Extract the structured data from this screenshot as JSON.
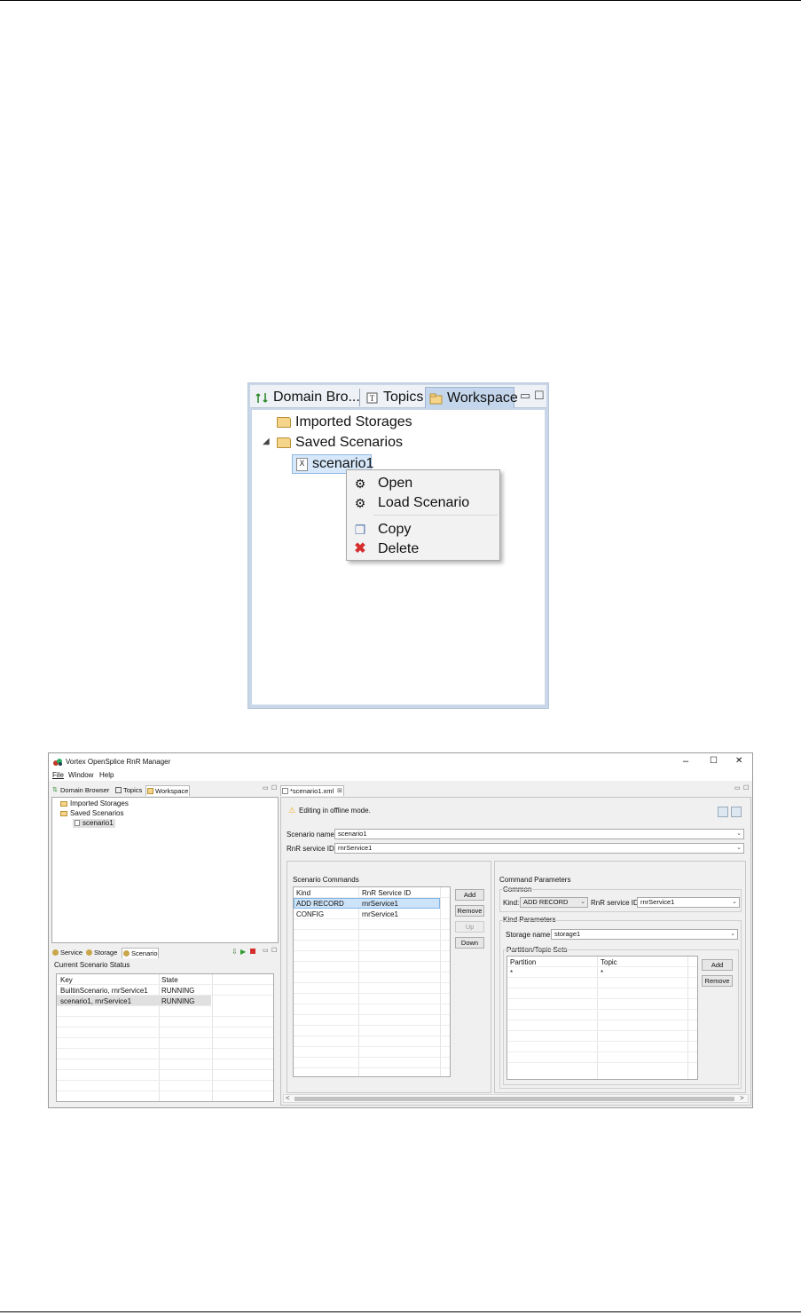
{
  "zoom_view": {
    "tabs": [
      {
        "label": "Domain Bro...",
        "icon": "domain-browser-icon"
      },
      {
        "label": "Topics",
        "icon": "topics-icon"
      },
      {
        "label": "Workspace",
        "icon": "workspace-icon"
      }
    ],
    "tree": {
      "imported_storages": "Imported Storages",
      "saved_scenarios": "Saved Scenarios",
      "scenario": "scenario1"
    },
    "context_menu": {
      "open": "Open",
      "load_scenario": "Load Scenario",
      "copy": "Copy",
      "delete": "Delete"
    }
  },
  "window": {
    "title": "Vortex OpenSplice RnR Manager",
    "menu": [
      "File",
      "Window",
      "Help"
    ],
    "controls": {
      "minimize": "–",
      "maximize": "☐",
      "close": "✕"
    },
    "left_tabs": [
      "Domain Browser",
      "Topics",
      "Workspace"
    ],
    "tree": {
      "imported_storages": "Imported Storages",
      "saved_scenarios": "Saved Scenarios",
      "scenario": "scenario1"
    },
    "bottom_tabs": [
      "Service",
      "Storage",
      "Scenario"
    ],
    "status": {
      "title": "Current Scenario Status",
      "columns": [
        "Key",
        "State"
      ],
      "rows": [
        [
          "BuiltinScenario, rnrService1",
          "RUNNING"
        ],
        [
          "scenario1, rnrService1",
          "RUNNING"
        ]
      ]
    },
    "editor": {
      "tab": "*scenario1.xml",
      "notice": "Editing in offline mode.",
      "scenario_name_label": "Scenario name:",
      "scenario_name": "scenario1",
      "service_id_label": "RnR service ID:",
      "service_id": "rnrService1",
      "commands": {
        "title": "Scenario Commands",
        "columns": [
          "Kind",
          "RnR Service ID"
        ],
        "rows": [
          [
            "ADD RECORD",
            "rnrService1"
          ],
          [
            "CONFIG",
            "rnrService1"
          ]
        ],
        "buttons": {
          "add": "Add",
          "remove": "Remove",
          "up": "Up",
          "down": "Down"
        }
      },
      "params": {
        "title": "Command Parameters",
        "common": "Common",
        "kind_label": "Kind:",
        "kind": "ADD RECORD",
        "service_label": "RnR service ID:",
        "service": "rnrService1",
        "kind_params": "Kind Parameters",
        "storage_label": "Storage name:",
        "storage": "storage1",
        "sets_title": "Partition/Topic Sets",
        "columns": [
          "Partition",
          "Topic"
        ],
        "rows": [
          [
            "*",
            "*"
          ]
        ],
        "buttons": {
          "add": "Add",
          "remove": "Remove"
        }
      }
    },
    "scroll": {
      "left": "<",
      "right": ">"
    }
  },
  "colors": {
    "selection": "#cde3f7",
    "panel": "#f0f0f0",
    "accent": "#c4d6ec",
    "delete_red": "#d62d2d",
    "warning": "#f2b01e"
  }
}
